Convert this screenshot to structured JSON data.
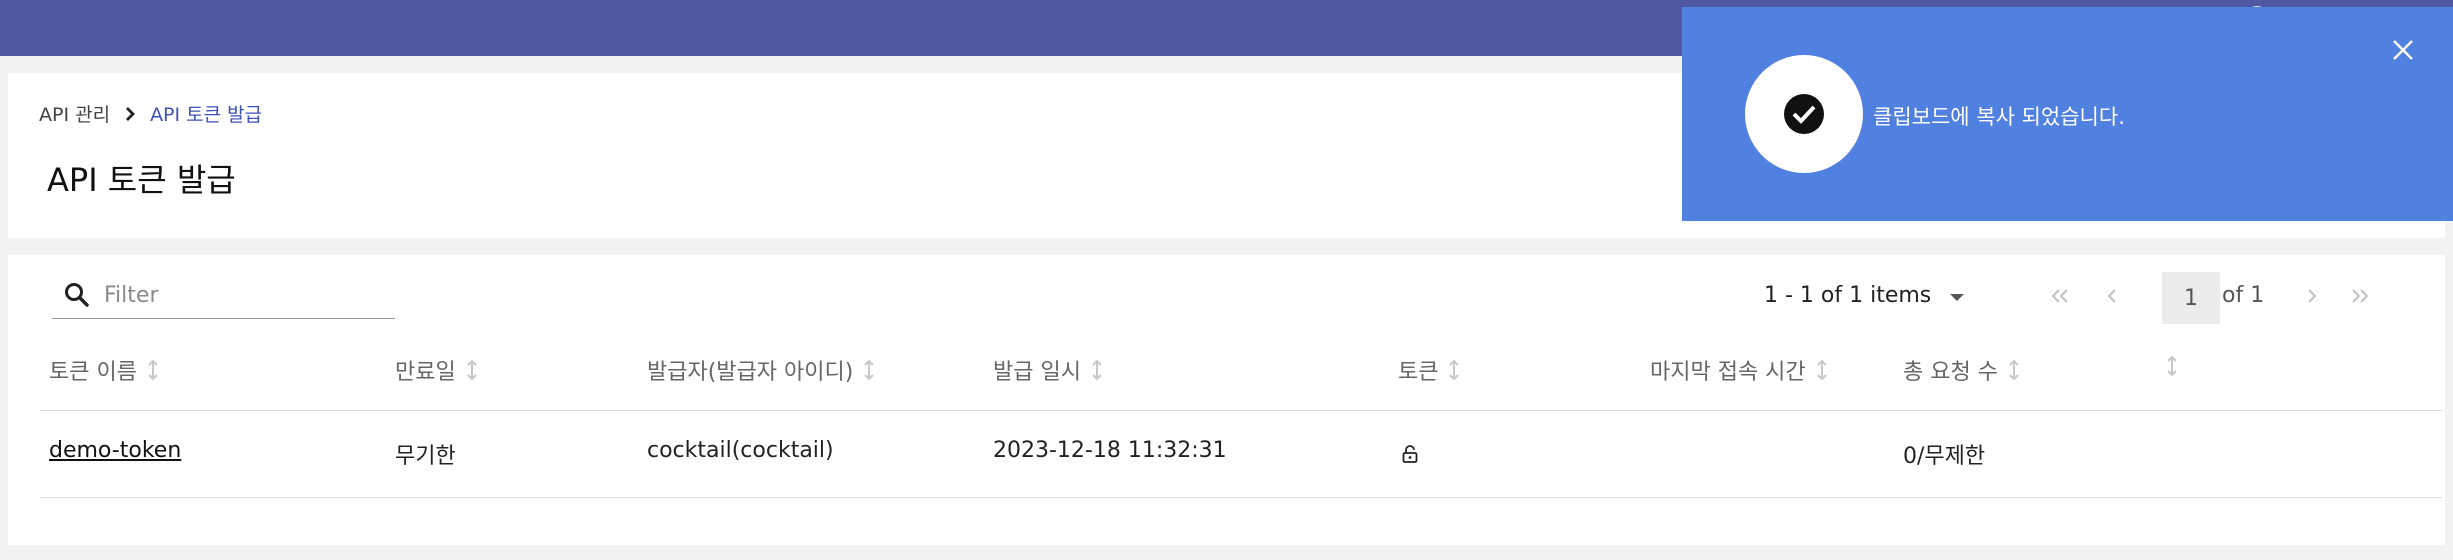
{
  "breadcrumb": {
    "parent": "API 관리",
    "current": "API 토큰 발급"
  },
  "page_title": "API 토큰 발급",
  "filter": {
    "placeholder": "Filter",
    "value": ""
  },
  "pagination": {
    "range_text": "1 - 1 of 1 items",
    "current_page": "1",
    "of_text": "of 1"
  },
  "table": {
    "columns": [
      "토큰 이름",
      "만료일",
      "발급자(발급자 아이디)",
      "발급 일시",
      "토큰",
      "마지막 접속 시간",
      "총 요청 수",
      ""
    ],
    "rows": [
      {
        "name": "demo-token",
        "expiry": "무기한",
        "issuer": "cocktail(cocktail)",
        "issued_at": "2023-12-18 11:32:31",
        "token_icon": "lock-icon",
        "last_access": "",
        "total_requests": "0/무제한"
      }
    ]
  },
  "toast": {
    "message": "클립보드에 복사 되었습니다.",
    "icon": "check-circle-icon"
  },
  "colors": {
    "topbar": "#5058a3",
    "accent": "#3f51b5",
    "toast_bg": "#5080e0"
  }
}
